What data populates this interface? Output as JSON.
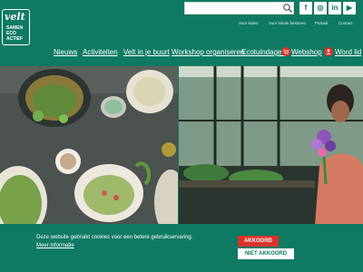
{
  "logo": {
    "word": "velt",
    "lines": [
      "SAMEN",
      "ECO",
      "ACTIEF"
    ]
  },
  "search": {
    "value": ""
  },
  "social": {
    "facebook": "f",
    "instagram": "◎",
    "linkedin": "in",
    "youtube": "▶"
  },
  "utility": {
    "items": [
      "Voor leden",
      "Voor lokale besturen",
      "Portaal",
      "Contact"
    ]
  },
  "nav": {
    "items": [
      "Nieuws",
      "Activiteiten",
      "Velt in je buurt",
      "Workshop organiseren",
      "Ecotuindagen"
    ],
    "webshop": "Webshop",
    "member": "Word lid"
  },
  "cookie": {
    "text": "Deze website gebruikt cookies voor een betere gebruikservaring.",
    "link": "Meer informatie",
    "accept": "AKKOORD",
    "decline": "NIET AKKOORD"
  },
  "colors": {
    "brand": "#0f7a63",
    "accent": "#d9342b"
  }
}
